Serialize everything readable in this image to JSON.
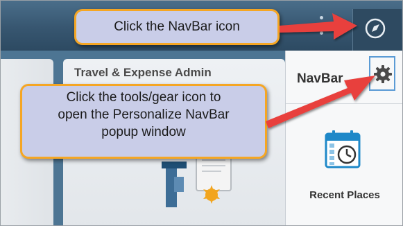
{
  "annotations": {
    "callout_navbar": "Click the NavBar icon",
    "callout_gear_lines": [
      "Click the tools/gear icon to",
      "open the Personalize NavBar",
      "popup window"
    ]
  },
  "homepage": {
    "tile_title": "Travel & Expense Admin"
  },
  "navbar": {
    "title": "NavBar",
    "tiles": [
      {
        "label": "Recent Places",
        "icon": "calendar-clock-icon"
      }
    ]
  },
  "icons": {
    "header_menu": "vertical-dots-icon",
    "navbar_button": "compass-icon",
    "personalize": "gear-icon"
  },
  "colors": {
    "header": "#375670",
    "callout_fill": "#c9cde8",
    "callout_border": "#f5a623",
    "arrow": "#e8413c",
    "gear_highlight": "#5b9bd5",
    "calendar": "#1e88c8"
  }
}
